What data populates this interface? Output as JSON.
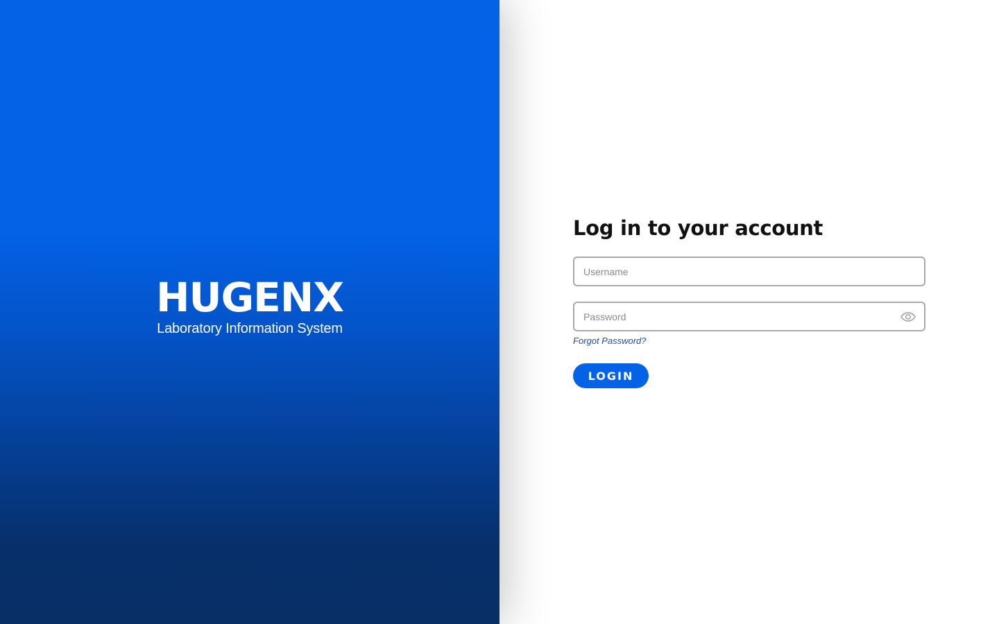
{
  "brand": {
    "logo_text": "HUGENX",
    "subtitle": "Laboratory Information System"
  },
  "login_form": {
    "title": "Log in to your account",
    "username_placeholder": "Username",
    "username_value": "",
    "password_placeholder": "Password",
    "password_value": "",
    "password_toggle_icon": "eye-icon",
    "forgot_password_label": "Forgot Password?",
    "login_label": "LOGIN"
  },
  "colors": {
    "brand_blue": "#0362e6",
    "brand_navy": "#082f66",
    "link_blue": "#1b4eb8",
    "input_border": "#a9a9a9"
  }
}
